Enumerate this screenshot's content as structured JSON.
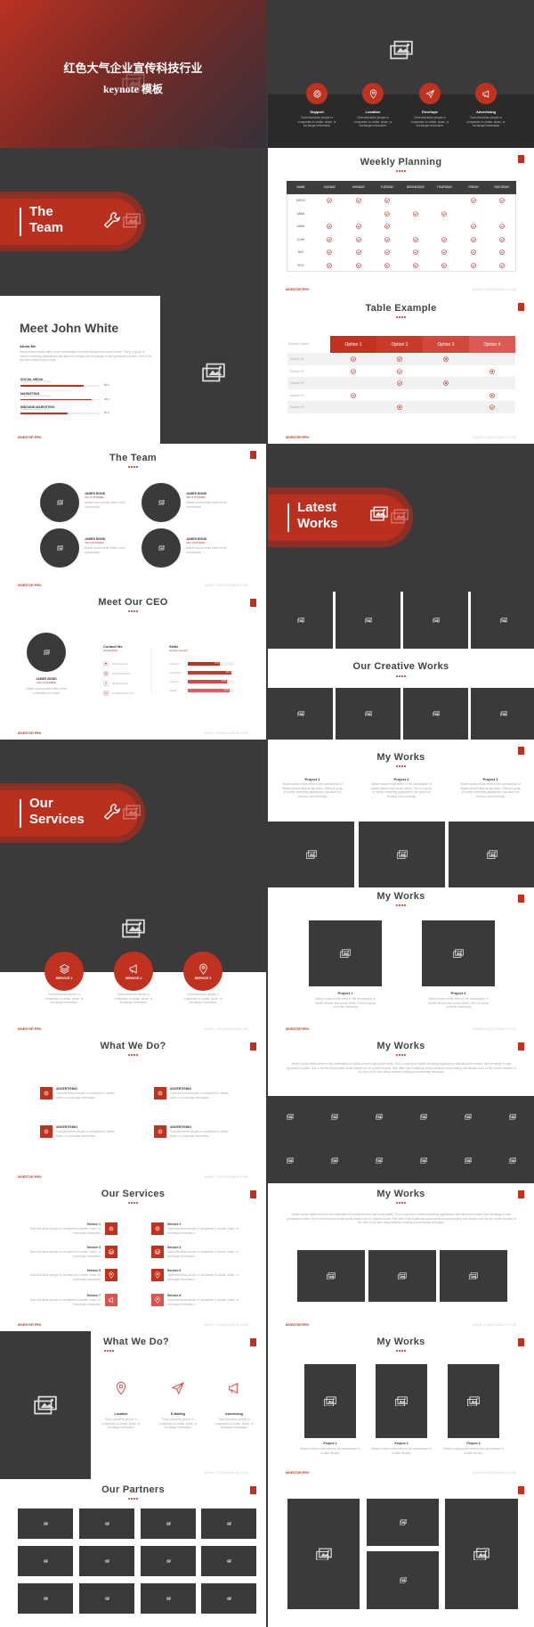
{
  "colors": {
    "accent": "#c0321f",
    "dark": "#3a3a3a"
  },
  "footer": {
    "brand": "INVESTOR PRO",
    "url": "WWW.YOURDOMAIN.COM"
  },
  "cover": {
    "line1": "红色大气企业宣传科技行业",
    "line2": "keynote 模板"
  },
  "features": [
    {
      "label": "Support",
      "icon": "lifebuoy-icon",
      "text": "Tools that allow people or companies to create, share, or exchange information"
    },
    {
      "label": "Location",
      "icon": "location-pin-icon",
      "text": "Tools that allow people or companies to create, share, or exchange information"
    },
    {
      "label": "Envelope",
      "icon": "paper-plane-icon",
      "text": "Tools that allow people or companies to create, share, or exchange information"
    },
    {
      "label": "Advertising",
      "icon": "megaphone-icon",
      "text": "Tools that allow people or companies to create, share, or exchange information"
    }
  ],
  "sections": {
    "team": {
      "l1": "The",
      "l2": "Team"
    },
    "works": {
      "l1": "Latest",
      "l2": "Works"
    },
    "services": {
      "l1": "Our",
      "l2": "Services"
    }
  },
  "weekly": {
    "title": "Weekly Planning",
    "headers": [
      "NAME",
      "SUNDAY",
      "MONDAY",
      "TUESDAY",
      "WEDNESDAY",
      "THURSDAY",
      "FRIDAY",
      "SATURDAY"
    ],
    "rows": [
      {
        "name": "DIEGO",
        "days": [
          1,
          1,
          1,
          0,
          0,
          1,
          1
        ]
      },
      {
        "name": "ANNA",
        "days": [
          0,
          0,
          1,
          1,
          1,
          0,
          0
        ]
      },
      {
        "name": "ANNA",
        "days": [
          1,
          1,
          1,
          0,
          0,
          1,
          1
        ]
      },
      {
        "name": "JOHN",
        "days": [
          1,
          1,
          1,
          1,
          1,
          1,
          1
        ]
      },
      {
        "name": "RAY",
        "days": [
          1,
          1,
          1,
          1,
          1,
          1,
          1
        ]
      },
      {
        "name": "RICK",
        "days": [
          1,
          1,
          1,
          1,
          1,
          1,
          1
        ]
      }
    ]
  },
  "john": {
    "title": "Meet John White",
    "about": "About Me",
    "bio": "Mobile social media refers to the combination of mobile devices and social media. This is a group of mobile marketing applications that allow the creation and exchange of user generated content. Due to the fact that mobile social media",
    "skills": [
      {
        "label": "SOCIAL MEDIA",
        "sub": "TYPEWRITING, WRITING CONTENT",
        "value": 80,
        "pct": "80 %"
      },
      {
        "label": "MARKETING",
        "sub": "TYPEWRITING, WRITING CONTENT",
        "value": 90,
        "pct": "90 %"
      },
      {
        "label": "INBOUND MARKETING",
        "sub": "TYPEWRITING, WRITING CONTENT",
        "value": 60,
        "pct": "60 %"
      }
    ]
  },
  "table_example": {
    "title": "Table Example",
    "corner": "Director Name",
    "options": [
      "Option 1",
      "Option 2",
      "Option 3",
      "Option 4"
    ],
    "option_colors": [
      "#c4321f",
      "#c93a2b",
      "#d2463c",
      "#db5a54"
    ],
    "rows": [
      {
        "name": "Director 01",
        "cells": [
          "check",
          "check",
          "cross",
          ""
        ]
      },
      {
        "name": "Director 02",
        "cells": [
          "check",
          "check",
          "",
          "cross"
        ]
      },
      {
        "name": "Director 03",
        "cells": [
          "",
          "check",
          "cross",
          ""
        ]
      },
      {
        "name": "Director 04",
        "cells": [
          "check",
          "",
          "",
          "cross"
        ]
      },
      {
        "name": "Director 05",
        "cells": [
          "",
          "cross",
          "",
          "check"
        ]
      }
    ]
  },
  "team": {
    "title": "The Team",
    "members": [
      {
        "name": "JAMES BOND",
        "role": "CTO & FOUNDER",
        "text": "Mobile social media refers to the combination"
      },
      {
        "name": "JAMES BOND",
        "role": "CEO & FOUNDER",
        "text": "Mobile social media refers to the combination"
      },
      {
        "name": "JAMES BOND",
        "role": "CEO & FOUNDER",
        "text": "Mobile social media refers to the combination"
      },
      {
        "name": "JAMES BOND",
        "role": "CEO & FOUNDER",
        "text": "Mobile social media refers to the combination"
      }
    ]
  },
  "ceo": {
    "title": "Meet Our CEO",
    "name": "JAMES BOND",
    "role": "CEO & FOUNDER",
    "text": "Mobile social media refers to the combination of mobile",
    "contact_title": "Contact Me",
    "contact_sub": "Social Media",
    "contacts": [
      {
        "icon": "twitter-icon",
        "text": "/frameofspace"
      },
      {
        "icon": "instagram-icon",
        "text": "/@frameofspace"
      },
      {
        "icon": "facebook-icon",
        "text": "/frameofspace"
      },
      {
        "icon": "email-icon",
        "text": "email@domain.com"
      }
    ],
    "skills_title": "Skills",
    "skills_sub": "Graphic General",
    "skills": [
      {
        "label": "Illustrator",
        "value": 70,
        "pct": "70 %"
      },
      {
        "label": "Photoshop",
        "value": 95,
        "pct": "95 %"
      },
      {
        "label": "InDesign",
        "value": 85,
        "pct": "85 %"
      },
      {
        "label": "Sketch",
        "value": 90,
        "pct": "90 %"
      }
    ]
  },
  "creative": {
    "title": "Our Creative Works"
  },
  "works3": {
    "title": "My Works",
    "projects": [
      {
        "name": "Project 1",
        "text": "Mobile social media refers to the combination of mobile devices and social media. This is a group of mobile marketing applications that allow the creation and exchange"
      },
      {
        "name": "Project 2",
        "text": "Mobile social media refers to the combination of mobile devices and social media. This is a group of mobile marketing applications that allow the creation and exchange"
      },
      {
        "name": "Project 3",
        "text": "Mobile social media refers to the combination of mobile devices and social media. This is a group of mobile marketing applications that allow the creation and exchange"
      }
    ]
  },
  "services_circles": [
    {
      "label": "SERVICE 1",
      "icon": "layers-icon",
      "text": "Tools that allow people or companies to create, share, or exchange information"
    },
    {
      "label": "SERVICE 2",
      "icon": "megaphone-icon",
      "text": "Tools that allow people or companies to create, share, or exchange information"
    },
    {
      "label": "SERVICE 3",
      "icon": "location-pin-icon",
      "text": "Tools that allow people or companies to create, share, or exchange information"
    }
  ],
  "works2": {
    "title": "My Works",
    "projects": [
      {
        "name": "Project 1",
        "text": "Mobile social media refers to the combination of mobile devices and social media. This is a group of mobile marketing"
      },
      {
        "name": "Project 2",
        "text": "Mobile social media refers to the combination of mobile devices and social media. This is a group of mobile marketing"
      }
    ]
  },
  "whatwedo": {
    "title": "What We Do?",
    "items": [
      {
        "label": "ADVERTISING",
        "text": "Tools that allow people or companies to create, share, or exchange information"
      },
      {
        "label": "ADVERTISING",
        "text": "Tools that allow people or companies to create, share, or exchange information"
      },
      {
        "label": "ADVERTISING",
        "text": "Tools that allow people or companies to create, share, or exchange information"
      },
      {
        "label": "ADVERTISING",
        "text": "Tools that allow people or companies to create, share, or exchange information"
      }
    ]
  },
  "works_band": {
    "title": "My Works",
    "text": "Mobile social media refers to the combination of mobile devices and social media. This is a group of mobile marketing applications that allow the creation and exchange of user generated content. Due to the fact that mobile social media runs on mobile devices, they differ from traditional social media by incorporating new factors such as the current location of the user or the time delay between sending and receiving messages."
  },
  "services8": {
    "title": "Our Services",
    "items": [
      {
        "label": "Service 1",
        "text": "Tools that allow people or companies to create, share, or exchange information"
      },
      {
        "label": "Service 2",
        "text": "Tools that allow people or companies to create, share, or exchange information"
      },
      {
        "label": "Service 3",
        "text": "Tools that allow people or companies to create, share, or exchange information"
      },
      {
        "label": "Service 4",
        "text": "Tools that allow people or companies to create, share, or exchange information"
      },
      {
        "label": "Service 5",
        "text": "Tools that allow people or companies to create, share, or exchange information"
      },
      {
        "label": "Service 6",
        "text": "Tools that allow people or companies to create, share, or exchange information"
      },
      {
        "label": "Service 7",
        "text": "Tools that allow people or companies to create, share, or exchange information"
      },
      {
        "label": "Service 8",
        "text": "Tools that allow people or companies to create, share, or exchange information"
      }
    ]
  },
  "works_three_img": {
    "title": "My Works",
    "text": "Mobile social media refers to the combination of mobile devices and social media. This is a group of mobile marketing applications that allow the creation and exchange of user generated content. Due to the fact that mobile social media runs on mobile devices, they differ from traditional social media by incorporating new factors such as the current location of the user or the time delay between sending and receiving messages."
  },
  "whatwedo3": {
    "title": "What We Do?",
    "items": [
      {
        "label": "Location",
        "icon": "location-pin-icon",
        "text": "Tools that allow people or companies to create, share, or exchange information"
      },
      {
        "label": "E-Mailing",
        "icon": "paper-plane-icon",
        "text": "Tools that allow people or companies to create, share, or exchange information"
      },
      {
        "label": "Advertising",
        "icon": "megaphone-icon",
        "text": "Tools that allow people or companies to create, share, or exchange information"
      }
    ]
  },
  "works_tall": {
    "title": "My Works",
    "projects": [
      {
        "name": "Project 1",
        "text": "Mobile social media refers to the combination of mobile devices"
      },
      {
        "name": "Project 2",
        "text": "Mobile social media refers to the combination of mobile devices"
      },
      {
        "name": "Project 3",
        "text": "Mobile social media refers to the combination of mobile devices"
      }
    ]
  },
  "partners": {
    "title": "Our Partners"
  }
}
